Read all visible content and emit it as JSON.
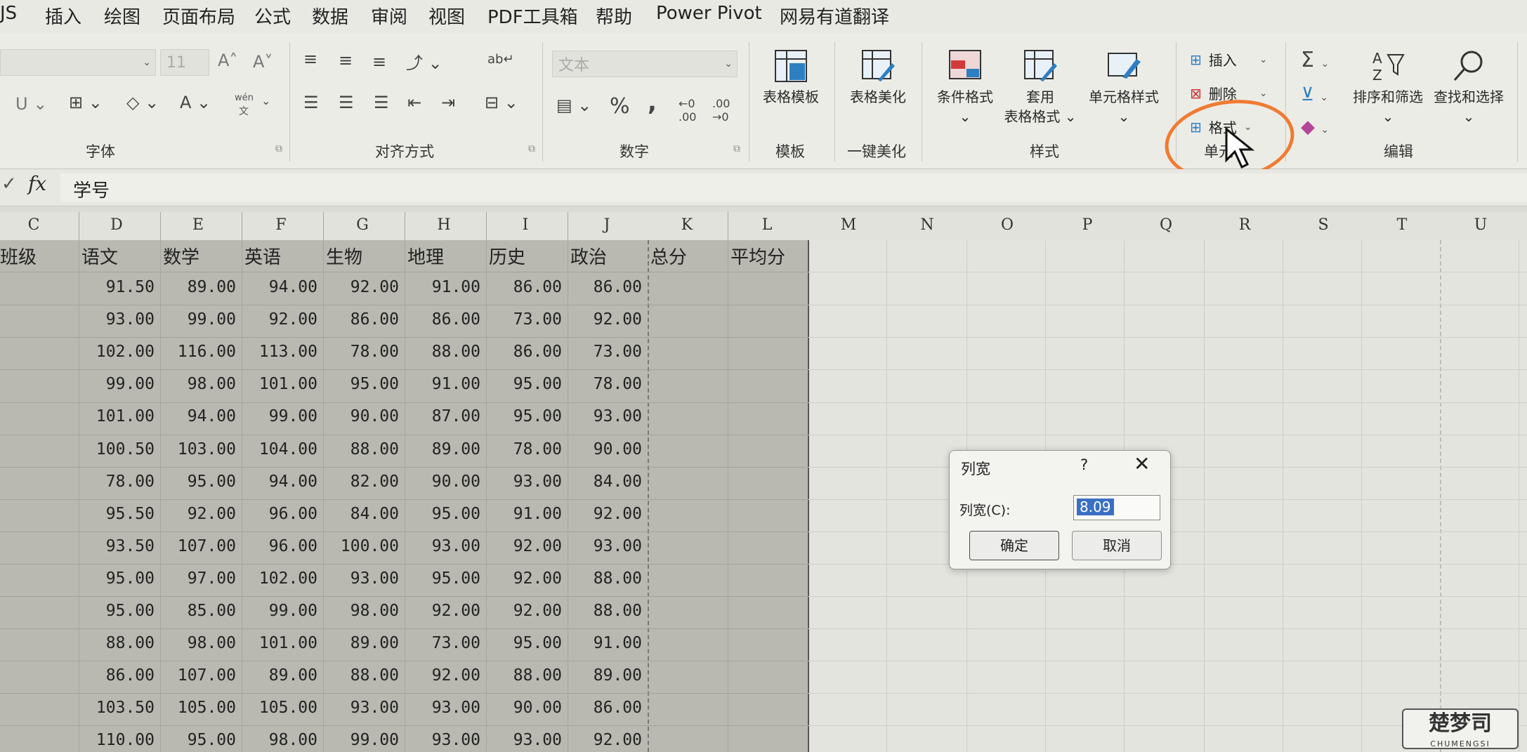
{
  "menu": [
    "JS",
    "插入",
    "绘图",
    "页面布局",
    "公式",
    "数据",
    "审阅",
    "视图",
    "PDF工具箱",
    "帮助",
    "Power Pivot",
    "网易有道翻译"
  ],
  "ribbon": {
    "font": {
      "size": "11",
      "group_label": "字体",
      "bold_pinyin": "wén",
      "bold_char": "文"
    },
    "alignment": {
      "group_label": "对齐方式"
    },
    "number": {
      "format": "文本",
      "group_label": "数字",
      "percent": "%",
      "comma": ","
    },
    "template": {
      "button": "表格模板",
      "group_label": "模板"
    },
    "beautify": {
      "button": "表格美化",
      "group_label": "一键美化"
    },
    "styles": {
      "conditional": "条件格式",
      "table_format_l1": "套用",
      "table_format_l2": "表格格式",
      "cell_style": "单元格样式",
      "group_label": "样式"
    },
    "cells": {
      "insert": "插入",
      "delete": "删除",
      "format": "格式",
      "group_label": "单元"
    },
    "editing": {
      "sort_filter": "排序和筛选",
      "find_select": "查找和选择",
      "group_label": "编辑"
    }
  },
  "formula_bar": {
    "fx": "fx",
    "content": "学号"
  },
  "columns": [
    "C",
    "D",
    "E",
    "F",
    "G",
    "H",
    "I",
    "J",
    "K",
    "L",
    "M",
    "N",
    "O",
    "P",
    "Q",
    "R",
    "S",
    "T",
    "U"
  ],
  "table": {
    "headers": [
      "班级",
      "语文",
      "数学",
      "英语",
      "生物",
      "地理",
      "历史",
      "政治",
      "总分",
      "平均分"
    ],
    "rows": [
      [
        "91.50",
        "89.00",
        "94.00",
        "92.00",
        "91.00",
        "86.00",
        "86.00"
      ],
      [
        "93.00",
        "99.00",
        "92.00",
        "86.00",
        "86.00",
        "73.00",
        "92.00"
      ],
      [
        "102.00",
        "116.00",
        "113.00",
        "78.00",
        "88.00",
        "86.00",
        "73.00"
      ],
      [
        "99.00",
        "98.00",
        "101.00",
        "95.00",
        "91.00",
        "95.00",
        "78.00"
      ],
      [
        "101.00",
        "94.00",
        "99.00",
        "90.00",
        "87.00",
        "95.00",
        "93.00"
      ],
      [
        "100.50",
        "103.00",
        "104.00",
        "88.00",
        "89.00",
        "78.00",
        "90.00"
      ],
      [
        "78.00",
        "95.00",
        "94.00",
        "82.00",
        "90.00",
        "93.00",
        "84.00"
      ],
      [
        "95.50",
        "92.00",
        "96.00",
        "84.00",
        "95.00",
        "91.00",
        "92.00"
      ],
      [
        "93.50",
        "107.00",
        "96.00",
        "100.00",
        "93.00",
        "92.00",
        "93.00"
      ],
      [
        "95.00",
        "97.00",
        "102.00",
        "93.00",
        "95.00",
        "92.00",
        "88.00"
      ],
      [
        "95.00",
        "85.00",
        "99.00",
        "98.00",
        "92.00",
        "92.00",
        "88.00"
      ],
      [
        "88.00",
        "98.00",
        "101.00",
        "89.00",
        "73.00",
        "95.00",
        "91.00"
      ],
      [
        "86.00",
        "107.00",
        "89.00",
        "88.00",
        "92.00",
        "88.00",
        "89.00"
      ],
      [
        "103.50",
        "105.00",
        "105.00",
        "93.00",
        "93.00",
        "90.00",
        "86.00"
      ],
      [
        "110.00",
        "95.00",
        "98.00",
        "99.00",
        "93.00",
        "93.00",
        "92.00"
      ]
    ]
  },
  "dialog": {
    "title": "列宽",
    "help": "?",
    "close": "✕",
    "field_label": "列宽(C):",
    "field_value": "8.09",
    "ok": "确定",
    "cancel": "取消"
  },
  "watermark": {
    "text": "楚梦司",
    "sub": "CHUMENGSI"
  },
  "colors": {
    "annotation": "#f07b32",
    "selection_highlight": "#3b6fc4"
  }
}
